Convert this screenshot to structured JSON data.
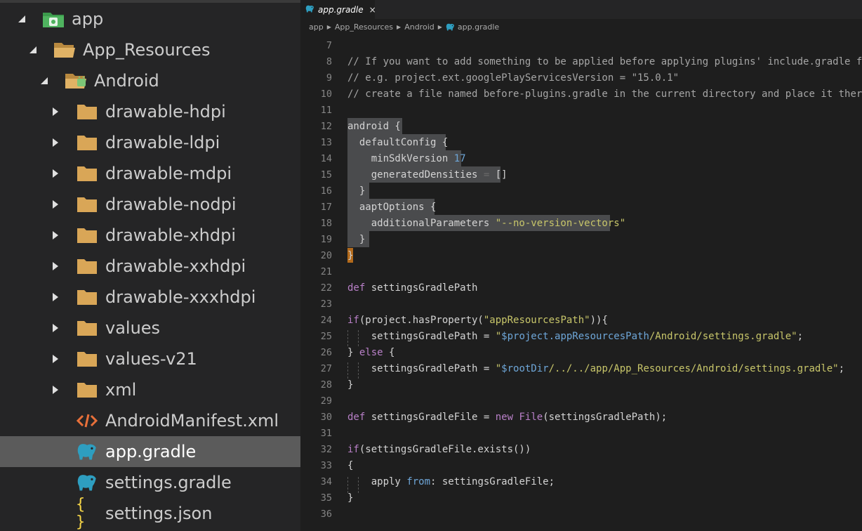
{
  "sidebar": {
    "items": [
      {
        "label": "app",
        "icon": "android-app-folder-icon",
        "expanded": true,
        "level": 0
      },
      {
        "label": "App_Resources",
        "icon": "folder-open-icon",
        "expanded": true,
        "level": 1
      },
      {
        "label": "Android",
        "icon": "android-folder-icon",
        "expanded": true,
        "level": 2
      },
      {
        "label": "drawable-hdpi",
        "icon": "folder-icon",
        "expanded": false,
        "level": 3
      },
      {
        "label": "drawable-ldpi",
        "icon": "folder-icon",
        "expanded": false,
        "level": 3
      },
      {
        "label": "drawable-mdpi",
        "icon": "folder-icon",
        "expanded": false,
        "level": 3
      },
      {
        "label": "drawable-nodpi",
        "icon": "folder-icon",
        "expanded": false,
        "level": 3
      },
      {
        "label": "drawable-xhdpi",
        "icon": "folder-icon",
        "expanded": false,
        "level": 3
      },
      {
        "label": "drawable-xxhdpi",
        "icon": "folder-icon",
        "expanded": false,
        "level": 3
      },
      {
        "label": "drawable-xxxhdpi",
        "icon": "folder-icon",
        "expanded": false,
        "level": 3
      },
      {
        "label": "values",
        "icon": "folder-icon",
        "expanded": false,
        "level": 3
      },
      {
        "label": "values-v21",
        "icon": "folder-icon",
        "expanded": false,
        "level": 3
      },
      {
        "label": "xml",
        "icon": "folder-icon",
        "expanded": false,
        "level": 3
      },
      {
        "label": "AndroidManifest.xml",
        "icon": "xml-file-icon",
        "level": 3,
        "file": true
      },
      {
        "label": "app.gradle",
        "icon": "gradle-elephant-icon",
        "level": 3,
        "file": true,
        "selected": true
      },
      {
        "label": "settings.gradle",
        "icon": "gradle-elephant-icon",
        "level": 3,
        "file": true
      },
      {
        "label": "settings.json",
        "icon": "json-braces-icon",
        "level": 3,
        "file": true
      }
    ]
  },
  "editor": {
    "tab": {
      "label": "app.gradle",
      "close": "×",
      "icon": "gradle-elephant-icon"
    },
    "breadcrumb": [
      "app",
      "App_Resources",
      "Android",
      "app.gradle"
    ],
    "line_numbers": [
      "7",
      "8",
      "9",
      "10",
      "11",
      "12",
      "13",
      "14",
      "15",
      "16",
      "17",
      "18",
      "19",
      "20",
      "21",
      "22",
      "23",
      "24",
      "25",
      "26",
      "27",
      "28",
      "29",
      "30",
      "31",
      "32",
      "33",
      "34",
      "35",
      "36"
    ],
    "code": {
      "l8": "// If you want to add something to be applied before applying plugins' include.gradle files",
      "l9": "// e.g. project.ext.googlePlayServicesVersion = \"15.0.1\"",
      "l10": "// create a file named before-plugins.gradle in the current directory and place it there",
      "l12": "android {",
      "l13": "  defaultConfig {",
      "l14_a": "    minSdkVersion ",
      "l14_b": "17",
      "l15_a": "    generatedDensities ",
      "l15_b": "=",
      "l15_c": " []",
      "l16": "  }",
      "l17": "  aaptOptions {",
      "l18_a": "    additionalParameters ",
      "l18_b": "\"--no-version-vectors\"",
      "l19": "  }",
      "l20": "}",
      "l22_a": "def",
      "l22_b": " settingsGradlePath",
      "l24_a": "if",
      "l24_b": "(project.hasProperty(",
      "l24_c": "\"appResourcesPath\"",
      "l24_d": ")){",
      "l25_a": "    settingsGradlePath = ",
      "l25_b": "\"",
      "l25_c": "$project.appResourcesPath",
      "l25_d": "/Android/settings.gradle\"",
      "l25_e": ";",
      "l26_a": "} ",
      "l26_b": "else",
      "l26_c": " {",
      "l27_a": "    settingsGradlePath = ",
      "l27_b": "\"",
      "l27_c": "$rootDir",
      "l27_d": "/../../app/App_Resources/Android/settings.gradle\"",
      "l27_e": ";",
      "l28": "}",
      "l30_a": "def",
      "l30_b": " settingsGradleFile = ",
      "l30_c": "new",
      "l30_d": " File",
      "l30_e": "(settingsGradlePath);",
      "l32_a": "if",
      "l32_b": "(settingsGradleFile.exists())",
      "l33": "{",
      "l34_a": "    apply ",
      "l34_b": "from",
      "l34_c": ": settingsGradleFile;",
      "l35": "}"
    }
  },
  "colors": {
    "sidebar_bg": "#252526",
    "editor_bg": "#1e1e1e",
    "selection": "#5b5b5b",
    "folder": "#d9a657",
    "android_green": "#5cb85c",
    "gradle": "#2e9ec0",
    "xml": "#e8703a",
    "json": "#f5d547"
  }
}
